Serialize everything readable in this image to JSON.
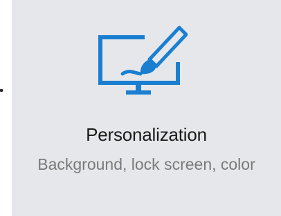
{
  "tile": {
    "icon": "personalization-icon",
    "title": "Personalization",
    "subtitle": "Background, lock screen, color"
  },
  "colors": {
    "accent": "#1a7fd1",
    "tile_background": "#e6e7eb",
    "title_text": "#1b1b1b",
    "subtitle_text": "#7a7a7a"
  }
}
